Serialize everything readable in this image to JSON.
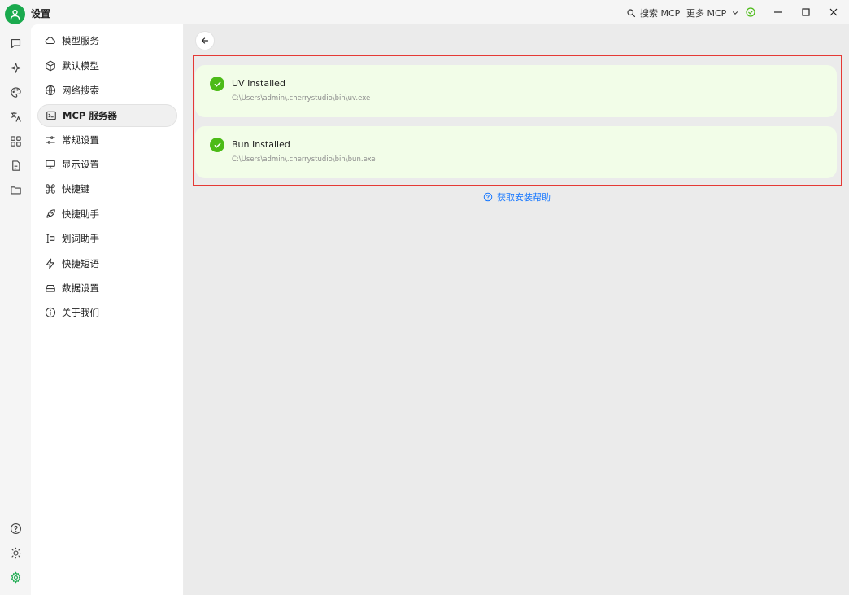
{
  "titlebar": {
    "title": "设置",
    "search_label": "搜索 MCP",
    "more_label": "更多 MCP"
  },
  "menu": {
    "items": [
      {
        "label": "模型服务",
        "icon": "cloud-icon"
      },
      {
        "label": "默认模型",
        "icon": "cube-icon"
      },
      {
        "label": "网络搜索",
        "icon": "globe-icon"
      },
      {
        "label": "MCP 服务器",
        "icon": "terminal-icon"
      },
      {
        "label": "常规设置",
        "icon": "sliders-icon"
      },
      {
        "label": "显示设置",
        "icon": "monitor-icon"
      },
      {
        "label": "快捷键",
        "icon": "command-icon"
      },
      {
        "label": "快捷助手",
        "icon": "rocket-icon"
      },
      {
        "label": "划词助手",
        "icon": "text-select-icon"
      },
      {
        "label": "快捷短语",
        "icon": "zap-icon"
      },
      {
        "label": "数据设置",
        "icon": "drive-icon"
      },
      {
        "label": "关于我们",
        "icon": "info-icon"
      }
    ],
    "active_index": 3
  },
  "main": {
    "cards": [
      {
        "title": "UV Installed",
        "path": "C:\\Users\\admin\\.cherrystudio\\bin\\uv.exe"
      },
      {
        "title": "Bun Installed",
        "path": "C:\\Users\\admin\\.cherrystudio\\bin\\bun.exe"
      }
    ],
    "help_label": "获取安装帮助"
  },
  "colors": {
    "accent": "#1aaa4e",
    "success": "#4cbb17",
    "card_bg": "#f2fde8",
    "link": "#1677ff",
    "highlight_border": "#e53935"
  }
}
